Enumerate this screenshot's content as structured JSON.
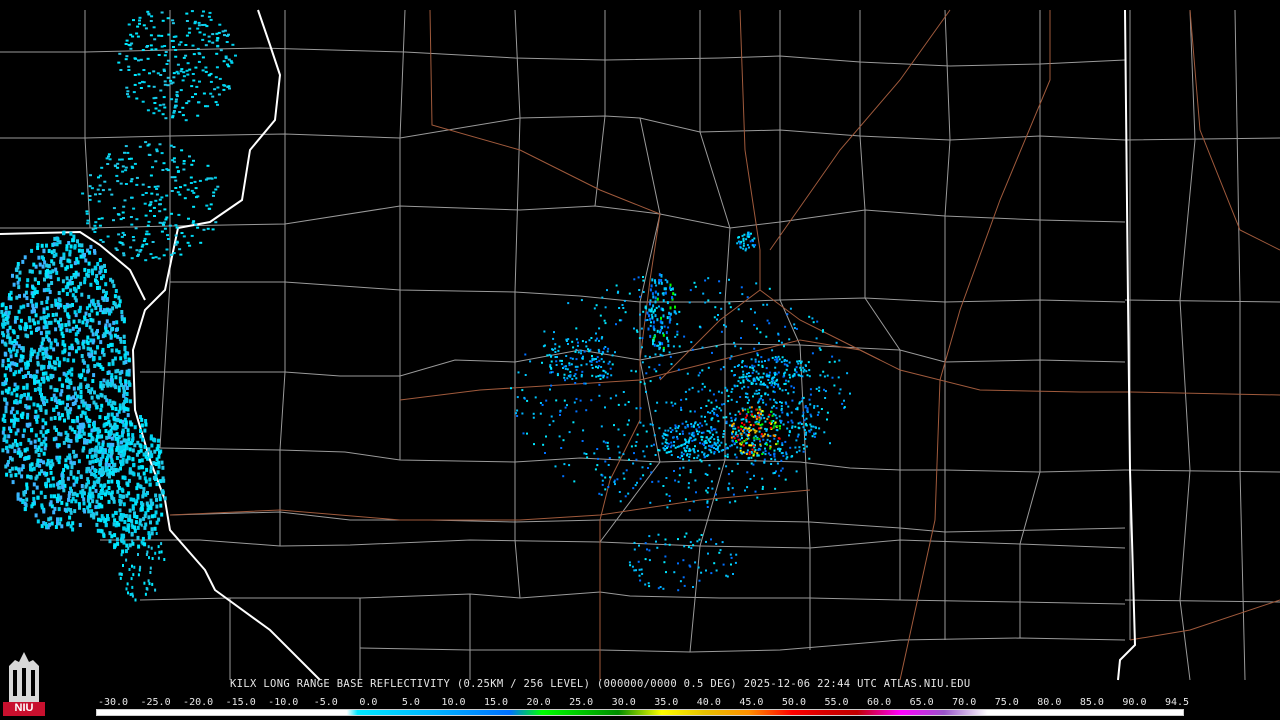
{
  "radar": {
    "product_caption": "KILX LONG RANGE BASE REFLECTIVITY (0.25KM / 256 LEVEL) (000000/0000 0.5 DEG) 2025-12-06 22:44 UTC  ATLAS.NIU.EDU"
  },
  "scale": {
    "labels": [
      "-30.0",
      "-25.0",
      "-20.0",
      "-15.0",
      "-10.0",
      "-5.0",
      "0.0",
      "5.0",
      "10.0",
      "15.0",
      "20.0",
      "25.0",
      "30.0",
      "35.0",
      "40.0",
      "45.0",
      "50.0",
      "55.0",
      "60.0",
      "65.0",
      "70.0",
      "75.0",
      "80.0",
      "85.0",
      "90.0",
      "94.5"
    ],
    "min_dbz": -30,
    "max_dbz": 94.5,
    "colors": {
      "low": "#ffffff",
      "zero": "#00e8ff",
      "five": "#00b4ff",
      "ten": "#0070ff",
      "fifteen": "#00ff00",
      "twenty": "#00c000",
      "twentyfive": "#008c00",
      "thirty": "#ffff00",
      "thirtyfive": "#e7c000",
      "forty": "#ff9000",
      "fortyfive": "#ff0000",
      "fifty": "#d60000",
      "fiftyfive": "#c00000",
      "sixty": "#ff00ff",
      "sixtyfive": "#9955c9",
      "seventy": "#ffffff"
    }
  },
  "map": {
    "border_color": "#ffffff",
    "county_color": "#9a9a9a",
    "highway_color": "#a05a3c",
    "background": "#000000"
  },
  "logo": {
    "label": "NIU"
  }
}
